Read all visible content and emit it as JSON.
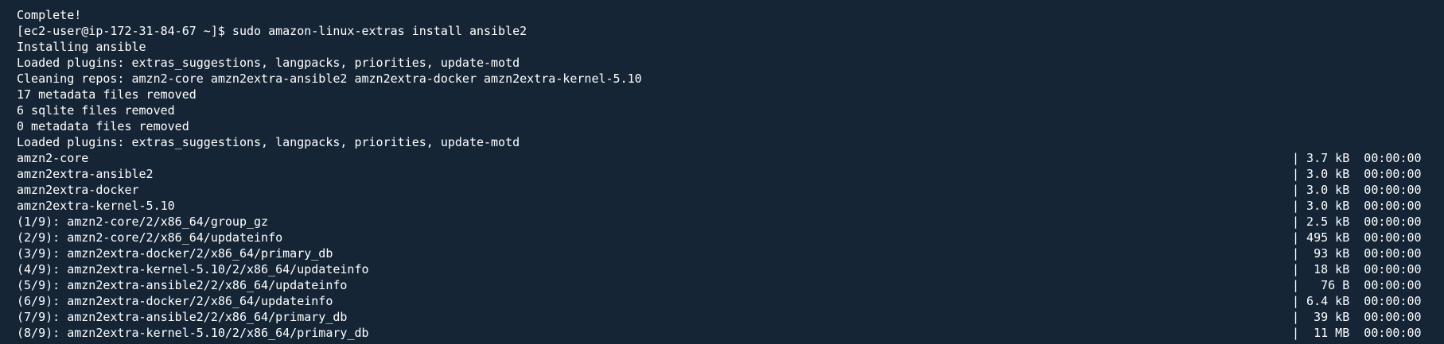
{
  "terminal": {
    "lines": [
      {
        "text": "Complete!",
        "right": ""
      },
      {
        "text": "[ec2-user@ip-172-31-84-67 ~]$ sudo amazon-linux-extras install ansible2",
        "right": ""
      },
      {
        "text": "Installing ansible",
        "right": ""
      },
      {
        "text": "Loaded plugins: extras_suggestions, langpacks, priorities, update-motd",
        "right": ""
      },
      {
        "text": "Cleaning repos: amzn2-core amzn2extra-ansible2 amzn2extra-docker amzn2extra-kernel-5.10",
        "right": ""
      },
      {
        "text": "17 metadata files removed",
        "right": ""
      },
      {
        "text": "6 sqlite files removed",
        "right": ""
      },
      {
        "text": "0 metadata files removed",
        "right": ""
      },
      {
        "text": "Loaded plugins: extras_suggestions, langpacks, priorities, update-motd",
        "right": ""
      },
      {
        "text": "amzn2-core",
        "right": "| 3.7 kB  00:00:00"
      },
      {
        "text": "amzn2extra-ansible2",
        "right": "| 3.0 kB  00:00:00"
      },
      {
        "text": "amzn2extra-docker",
        "right": "| 3.0 kB  00:00:00"
      },
      {
        "text": "amzn2extra-kernel-5.10",
        "right": "| 3.0 kB  00:00:00"
      },
      {
        "text": "(1/9): amzn2-core/2/x86_64/group_gz",
        "right": "| 2.5 kB  00:00:00"
      },
      {
        "text": "(2/9): amzn2-core/2/x86_64/updateinfo",
        "right": "| 495 kB  00:00:00"
      },
      {
        "text": "(3/9): amzn2extra-docker/2/x86_64/primary_db",
        "right": "|  93 kB  00:00:00"
      },
      {
        "text": "(4/9): amzn2extra-kernel-5.10/2/x86_64/updateinfo",
        "right": "|  18 kB  00:00:00"
      },
      {
        "text": "(5/9): amzn2extra-ansible2/2/x86_64/updateinfo",
        "right": "|   76 B  00:00:00"
      },
      {
        "text": "(6/9): amzn2extra-docker/2/x86_64/updateinfo",
        "right": "| 6.4 kB  00:00:00"
      },
      {
        "text": "(7/9): amzn2extra-ansible2/2/x86_64/primary_db",
        "right": "|  39 kB  00:00:00"
      },
      {
        "text": "(8/9): amzn2extra-kernel-5.10/2/x86_64/primary_db",
        "right": "|  11 MB  00:00:00"
      }
    ]
  }
}
